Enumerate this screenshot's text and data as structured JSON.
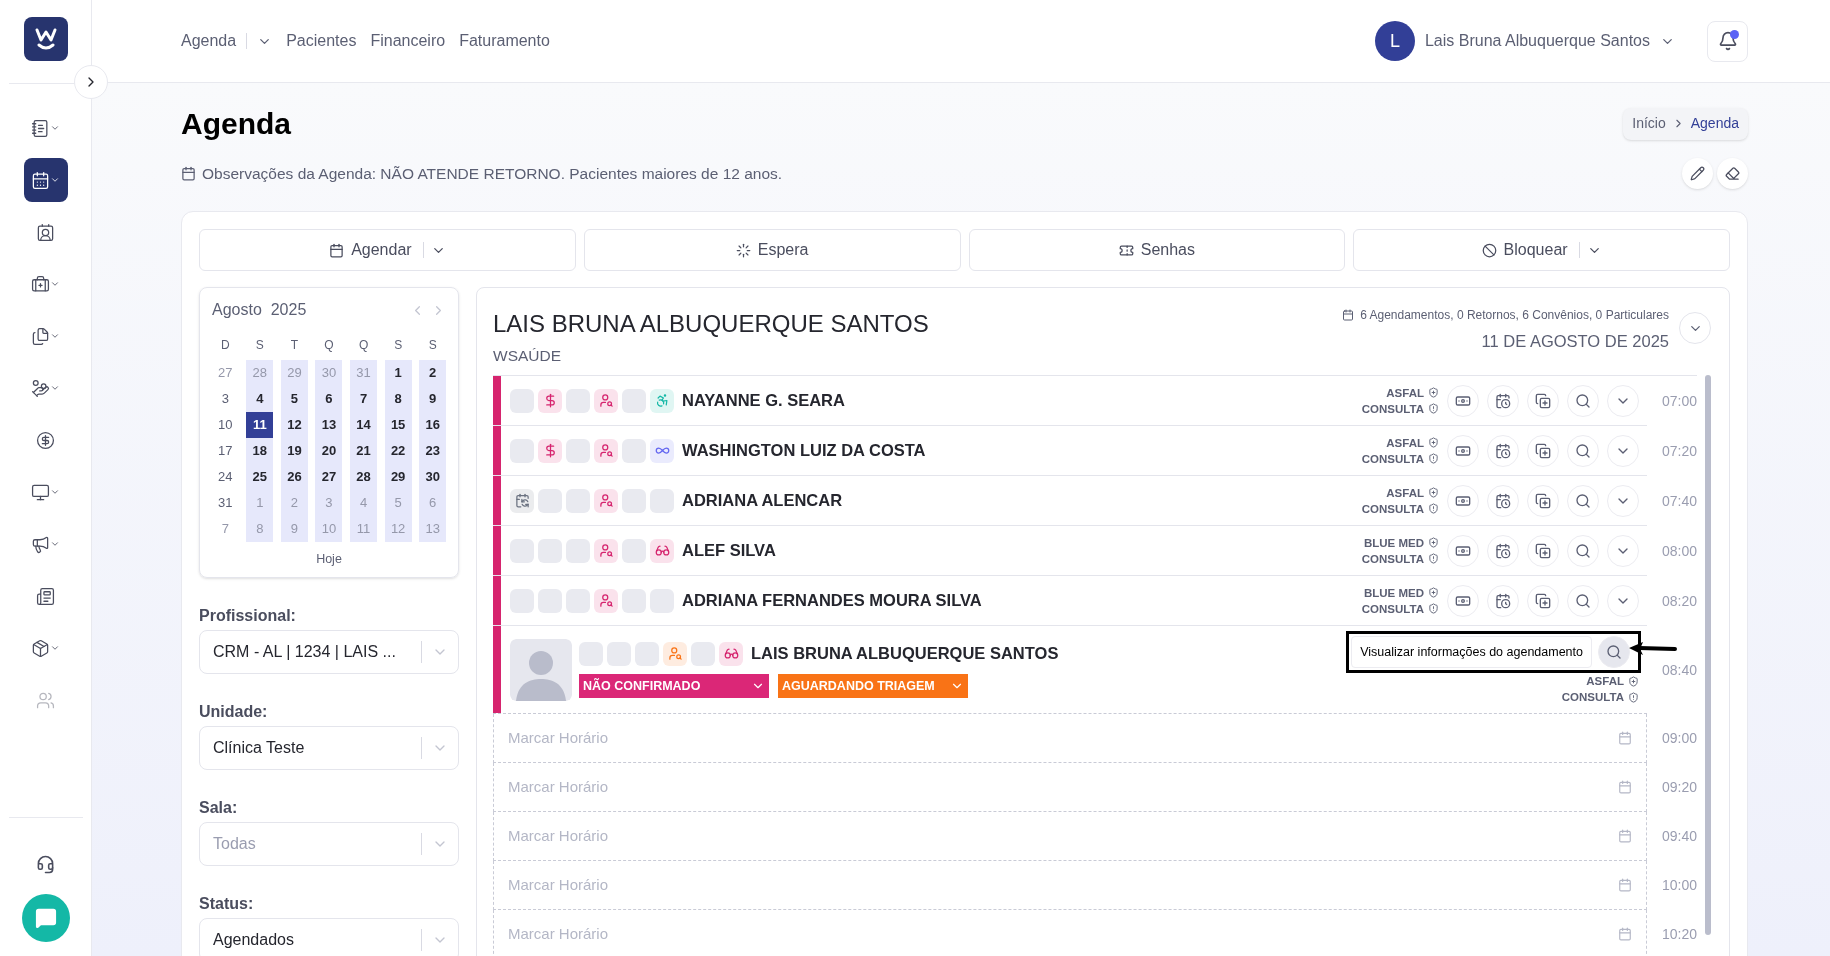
{
  "sidebar": {
    "items": [
      {
        "kind": "notebook",
        "caret": true,
        "selected": false,
        "disabled": false
      },
      {
        "kind": "calendar",
        "caret": true,
        "selected": true,
        "disabled": false
      },
      {
        "kind": "contact",
        "caret": false,
        "selected": false,
        "disabled": false
      },
      {
        "kind": "medical",
        "caret": true,
        "selected": false,
        "disabled": false
      },
      {
        "kind": "files",
        "caret": true,
        "selected": false,
        "disabled": false
      },
      {
        "kind": "hand",
        "caret": true,
        "selected": false,
        "disabled": false
      },
      {
        "kind": "dollar",
        "caret": false,
        "selected": false,
        "disabled": false
      },
      {
        "kind": "monitor",
        "caret": true,
        "selected": false,
        "disabled": false
      },
      {
        "kind": "megaphone",
        "caret": true,
        "selected": false,
        "disabled": false
      },
      {
        "kind": "newspaper",
        "caret": false,
        "selected": false,
        "disabled": false
      },
      {
        "kind": "package",
        "caret": true,
        "selected": false,
        "disabled": false
      },
      {
        "kind": "users",
        "caret": false,
        "selected": false,
        "disabled": true
      }
    ]
  },
  "nav": [
    {
      "label": "Agenda",
      "dropdown": true
    },
    {
      "label": "Pacientes",
      "dropdown": false
    },
    {
      "label": "Financeiro",
      "dropdown": false
    },
    {
      "label": "Faturamento",
      "dropdown": false
    }
  ],
  "user": {
    "initial": "L",
    "name": "Lais Bruna Albuquerque Santos",
    "unread": true
  },
  "page": {
    "title": "Agenda",
    "breadcrumb": [
      "Início",
      "Agenda"
    ],
    "notes": "Observações da Agenda: NÃO ATENDE RETORNO. Pacientes maiores de 12 anos."
  },
  "actions": [
    {
      "kind": "calendar",
      "label": "Agendar",
      "dropdown": true
    },
    {
      "kind": "loader",
      "label": "Espera",
      "dropdown": false
    },
    {
      "kind": "ticket",
      "label": "Senhas",
      "dropdown": false
    },
    {
      "kind": "ban",
      "label": "Bloquear",
      "dropdown": true
    }
  ],
  "calendar": {
    "month": "Agosto",
    "year": "2025",
    "footer": "Hoje",
    "weekdays": [
      {
        "label": "D",
        "highlighted": false
      },
      {
        "label": "S",
        "highlighted": true
      },
      {
        "label": "T",
        "highlighted": true
      },
      {
        "label": "Q",
        "highlighted": true
      },
      {
        "label": "Q",
        "highlighted": true
      },
      {
        "label": "S",
        "highlighted": true
      },
      {
        "label": "S",
        "highlighted": true
      }
    ],
    "weeks": [
      [
        {
          "d": "27",
          "muted": true,
          "selected": false
        },
        {
          "d": "28",
          "muted": true,
          "selected": false
        },
        {
          "d": "29",
          "muted": true,
          "selected": false
        },
        {
          "d": "30",
          "muted": true,
          "selected": false
        },
        {
          "d": "31",
          "muted": true,
          "selected": false
        },
        {
          "d": "1",
          "muted": false,
          "selected": false
        },
        {
          "d": "2",
          "muted": false,
          "selected": false
        }
      ],
      [
        {
          "d": "3",
          "muted": false,
          "selected": false
        },
        {
          "d": "4",
          "muted": false,
          "selected": false
        },
        {
          "d": "5",
          "muted": false,
          "selected": false
        },
        {
          "d": "6",
          "muted": false,
          "selected": false
        },
        {
          "d": "7",
          "muted": false,
          "selected": false
        },
        {
          "d": "8",
          "muted": false,
          "selected": false
        },
        {
          "d": "9",
          "muted": false,
          "selected": false
        }
      ],
      [
        {
          "d": "10",
          "muted": false,
          "selected": false
        },
        {
          "d": "11",
          "muted": false,
          "selected": true
        },
        {
          "d": "12",
          "muted": false,
          "selected": false
        },
        {
          "d": "13",
          "muted": false,
          "selected": false
        },
        {
          "d": "14",
          "muted": false,
          "selected": false
        },
        {
          "d": "15",
          "muted": false,
          "selected": false
        },
        {
          "d": "16",
          "muted": false,
          "selected": false
        }
      ],
      [
        {
          "d": "17",
          "muted": false,
          "selected": false
        },
        {
          "d": "18",
          "muted": false,
          "selected": false
        },
        {
          "d": "19",
          "muted": false,
          "selected": false
        },
        {
          "d": "20",
          "muted": false,
          "selected": false
        },
        {
          "d": "21",
          "muted": false,
          "selected": false
        },
        {
          "d": "22",
          "muted": false,
          "selected": false
        },
        {
          "d": "23",
          "muted": false,
          "selected": false
        }
      ],
      [
        {
          "d": "24",
          "muted": false,
          "selected": false
        },
        {
          "d": "25",
          "muted": false,
          "selected": false
        },
        {
          "d": "26",
          "muted": false,
          "selected": false
        },
        {
          "d": "27",
          "muted": false,
          "selected": false
        },
        {
          "d": "28",
          "muted": false,
          "selected": false
        },
        {
          "d": "29",
          "muted": false,
          "selected": false
        },
        {
          "d": "30",
          "muted": false,
          "selected": false
        }
      ],
      [
        {
          "d": "31",
          "muted": false,
          "selected": false
        },
        {
          "d": "1",
          "muted": true,
          "selected": false
        },
        {
          "d": "2",
          "muted": true,
          "selected": false
        },
        {
          "d": "3",
          "muted": true,
          "selected": false
        },
        {
          "d": "4",
          "muted": true,
          "selected": false
        },
        {
          "d": "5",
          "muted": true,
          "selected": false
        },
        {
          "d": "6",
          "muted": true,
          "selected": false
        }
      ],
      [
        {
          "d": "7",
          "muted": true,
          "selected": false
        },
        {
          "d": "8",
          "muted": true,
          "selected": false
        },
        {
          "d": "9",
          "muted": true,
          "selected": false
        },
        {
          "d": "10",
          "muted": true,
          "selected": false
        },
        {
          "d": "11",
          "muted": true,
          "selected": false
        },
        {
          "d": "12",
          "muted": true,
          "selected": false
        },
        {
          "d": "13",
          "muted": true,
          "selected": false
        }
      ]
    ]
  },
  "filters": [
    {
      "label": "Profissional:",
      "value": "CRM - AL | 1234 | LAIS ..."
    },
    {
      "label": "Unidade:",
      "value": "Clínica Teste"
    },
    {
      "label": "Sala:",
      "placeholder": "Todas"
    },
    {
      "label": "Status:",
      "value": "Agendados"
    }
  ],
  "schedule": {
    "title": "LAIS BRUNA ALBUQUERQUE SANTOS",
    "subtitle": "WSAÚDE",
    "summary": "6 Agendamentos, 0 Retornos, 6 Convênios, 0 Particulares",
    "date": "11 DE AGOSTO DE 2025",
    "slots": [
      {
        "kind": "booked",
        "time": "07:00",
        "name": "NAYANNE G. SEARA",
        "insurance": "ASFAL",
        "procedure": "CONSULTA",
        "color": "#d6246e",
        "flags": [
          {
            "kind": "empty"
          },
          {
            "kind": "money",
            "color": "#d6246e"
          },
          {
            "kind": "empty"
          },
          {
            "kind": "person",
            "color": "#d6246e"
          },
          {
            "kind": "empty"
          },
          {
            "kind": "accessibility",
            "color": "#14b8a6"
          }
        ]
      },
      {
        "kind": "booked",
        "time": "07:20",
        "name": "WASHINGTON LUIZ DA COSTA",
        "insurance": "ASFAL",
        "procedure": "CONSULTA",
        "color": "#d6246e",
        "flags": [
          {
            "kind": "empty"
          },
          {
            "kind": "money",
            "color": "#d6246e"
          },
          {
            "kind": "empty"
          },
          {
            "kind": "person",
            "color": "#d6246e"
          },
          {
            "kind": "empty"
          },
          {
            "kind": "infinity",
            "color": "#6366f1"
          }
        ]
      },
      {
        "kind": "booked",
        "time": "07:40",
        "name": "ADRIANA ALENCAR",
        "insurance": "ASFAL",
        "procedure": "CONSULTA",
        "color": "#d6246e",
        "flags": [
          {
            "kind": "calendar",
            "color": "#6b7280"
          },
          {
            "kind": "empty"
          },
          {
            "kind": "empty"
          },
          {
            "kind": "person",
            "color": "#d6246e"
          },
          {
            "kind": "empty"
          },
          {
            "kind": "empty"
          }
        ]
      },
      {
        "kind": "booked",
        "time": "08:00",
        "name": "ALEF SILVA",
        "insurance": "BLUE MED",
        "procedure": "CONSULTA",
        "color": "#d6246e",
        "flags": [
          {
            "kind": "empty"
          },
          {
            "kind": "empty"
          },
          {
            "kind": "empty"
          },
          {
            "kind": "person",
            "color": "#d6246e"
          },
          {
            "kind": "empty"
          },
          {
            "kind": "glasses",
            "color": "#d6246e"
          }
        ]
      },
      {
        "kind": "booked",
        "time": "08:20",
        "name": "ADRIANA FERNANDES MOURA SILVA",
        "insurance": "BLUE MED",
        "procedure": "CONSULTA",
        "color": "#d6246e",
        "flags": [
          {
            "kind": "empty"
          },
          {
            "kind": "empty"
          },
          {
            "kind": "empty"
          },
          {
            "kind": "person",
            "color": "#d6246e"
          },
          {
            "kind": "empty"
          },
          {
            "kind": "empty"
          }
        ]
      },
      {
        "kind": "expanded",
        "time": "08:40",
        "name": "LAIS BRUNA ALBUQUERQUE SANTOS",
        "insurance": "ASFAL",
        "procedure": "CONSULTA",
        "color": "#d6246e",
        "tooltip": "Visualizar informações do agendamento",
        "flags": [
          {
            "kind": "empty"
          },
          {
            "kind": "empty"
          },
          {
            "kind": "empty"
          },
          {
            "kind": "person",
            "color": "#f97316"
          },
          {
            "kind": "empty"
          },
          {
            "kind": "glasses",
            "color": "#d6246e"
          }
        ],
        "statuses": [
          {
            "label": "NÃO CONFIRMADO",
            "color": "#db2777"
          },
          {
            "label": "AGUARDANDO TRIAGEM",
            "color": "#f97316"
          }
        ]
      },
      {
        "kind": "open",
        "time": "09:00",
        "placeholder": "Marcar Horário"
      },
      {
        "kind": "open",
        "time": "09:20",
        "placeholder": "Marcar Horário"
      },
      {
        "kind": "open",
        "time": "09:40",
        "placeholder": "Marcar Horário"
      },
      {
        "kind": "open",
        "time": "10:00",
        "placeholder": "Marcar Horário"
      },
      {
        "kind": "open",
        "time": "10:20",
        "placeholder": "Marcar Horário"
      }
    ]
  }
}
